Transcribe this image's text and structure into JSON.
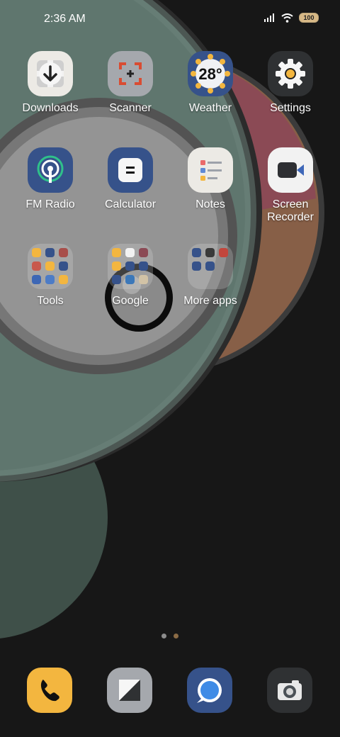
{
  "status": {
    "time": "2:36 AM",
    "battery": "100",
    "icons": [
      "signal-icon",
      "wifi-icon",
      "battery-icon"
    ]
  },
  "apps": {
    "downloads": "Downloads",
    "scanner": "Scanner",
    "weather": "Weather",
    "weather_temp": "28°",
    "settings": "Settings",
    "fm_radio": "FM Radio",
    "calculator": "Calculator",
    "notes": "Notes",
    "screen_recorder": "Screen\nRecorder"
  },
  "folders": {
    "tools": "Tools",
    "google": "Google",
    "more_apps": "More apps"
  },
  "dock": {
    "items": [
      "phone-icon",
      "messaging-icon",
      "browser-icon",
      "camera-icon"
    ]
  },
  "page_indicator": {
    "total": 2,
    "current": 2
  },
  "colors": {
    "background": "#171717",
    "accent": "#f3b63f"
  }
}
